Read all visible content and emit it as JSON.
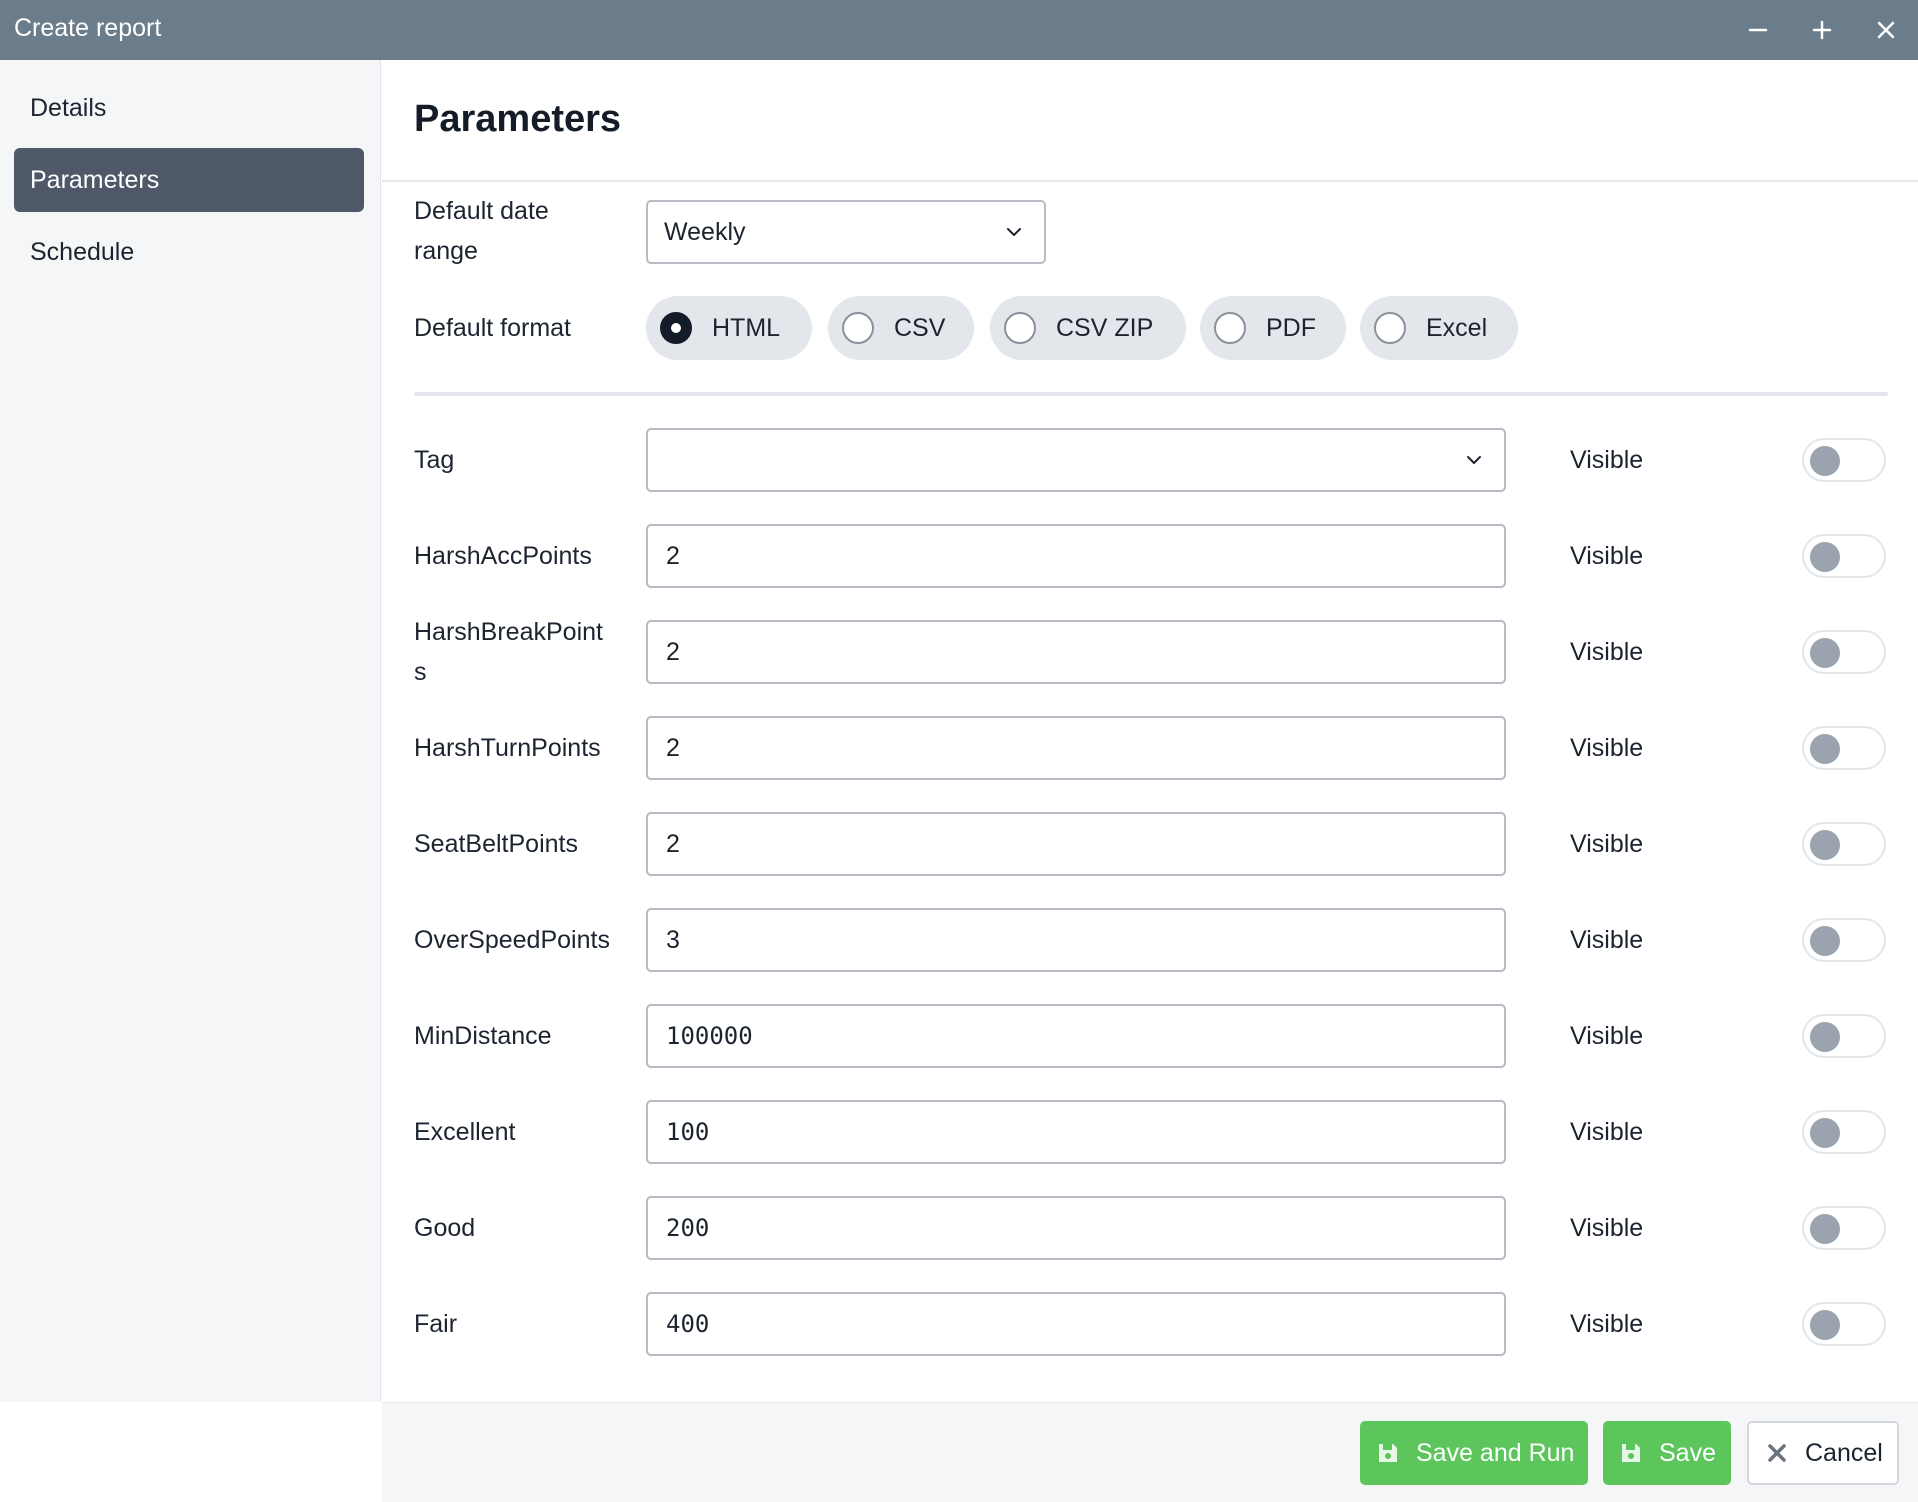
{
  "window": {
    "title": "Create report"
  },
  "sidebar": {
    "items": [
      {
        "label": "Details",
        "active": false
      },
      {
        "label": "Parameters",
        "active": true
      },
      {
        "label": "Schedule",
        "active": false
      }
    ]
  },
  "main": {
    "title": "Parameters",
    "date_range": {
      "label_line1": "Default date",
      "label_line2": "range",
      "value": "Weekly"
    },
    "format": {
      "label": "Default format",
      "options": [
        "HTML",
        "CSV",
        "CSV ZIP",
        "PDF",
        "Excel"
      ],
      "selected": "HTML"
    },
    "tag": {
      "label": "Tag",
      "value": "",
      "visible_label": "Visible"
    },
    "params": [
      {
        "label": "HarshAccPoints",
        "value": "2",
        "visible_label": "Visible"
      },
      {
        "label_line1": "HarshBreakPoint",
        "label_line2": "s",
        "value": "2",
        "visible_label": "Visible"
      },
      {
        "label": "HarshTurnPoints",
        "value": "2",
        "visible_label": "Visible"
      },
      {
        "label": "SeatBeltPoints",
        "value": "2",
        "visible_label": "Visible"
      },
      {
        "label": "OverSpeedPoints",
        "value": "3",
        "visible_label": "Visible"
      },
      {
        "label": "MinDistance",
        "value": "100000",
        "visible_label": "Visible"
      },
      {
        "label": "Excellent",
        "value": "100",
        "visible_label": "Visible"
      },
      {
        "label": "Good",
        "value": "200",
        "visible_label": "Visible"
      },
      {
        "label": "Fair",
        "value": "400",
        "visible_label": "Visible"
      }
    ]
  },
  "footer": {
    "save_and_run": "Save and Run",
    "save": "Save",
    "cancel": "Cancel"
  },
  "colors": {
    "titlebar": "#6b7d8a",
    "sidebar_active": "#4f5868",
    "primary_green": "#5cc65c",
    "toggle_off_knob": "#9aa3ae"
  },
  "icons": {
    "minimize": "minus-icon",
    "maximize": "plus-icon",
    "close": "close-icon",
    "dropdown": "chevron-down-icon",
    "save": "floppy-disk-icon",
    "cancel": "x-icon"
  }
}
